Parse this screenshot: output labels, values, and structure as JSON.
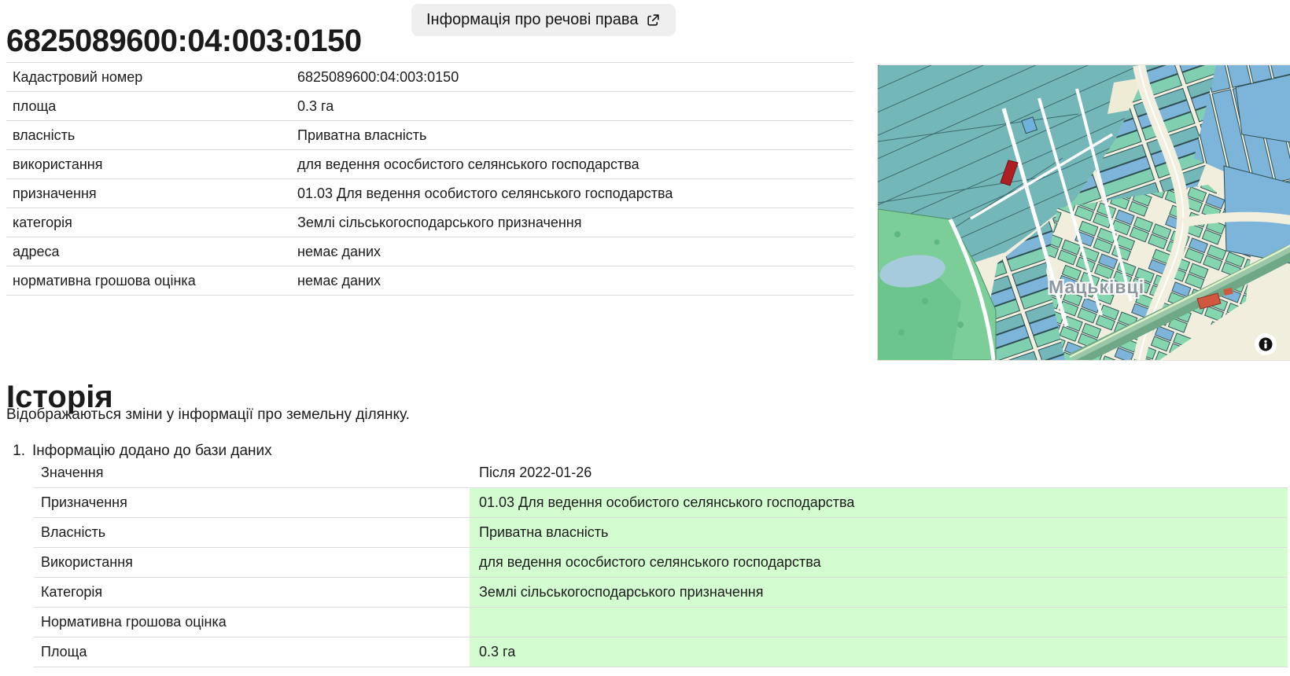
{
  "page": {
    "title": "6825089600:04:003:0150",
    "rights_button": {
      "label": "Інформація про речові права",
      "icon": "external-link-icon"
    }
  },
  "parcel_table": {
    "rows": [
      {
        "label": "Кадастровий номер",
        "value": "6825089600:04:003:0150"
      },
      {
        "label": "площа",
        "value": "0.3 га"
      },
      {
        "label": "власність",
        "value": "Приватна власність"
      },
      {
        "label": "використання",
        "value": "для ведення ососбистого селянського господарства"
      },
      {
        "label": "призначення",
        "value": "01.03 Для ведення особистого селянського господарства"
      },
      {
        "label": "категорія",
        "value": "Землі сільськогосподарського призначення"
      },
      {
        "label": "адреса",
        "value": "немає даних"
      },
      {
        "label": "нормативна грошова оцінка",
        "value": "немає даних"
      }
    ]
  },
  "map": {
    "label": "Мацьківці",
    "info_icon": "info-icon",
    "selected_parcel": "6825089600:04:003:0150",
    "colors": {
      "field_teal": "#73b7b9",
      "parcel_blue": "#7db4d9",
      "parcel_green": "#84d6ae",
      "road_cream": "#f1eedd",
      "forest_green": "#7bce97",
      "water_blue": "#a5cbdd",
      "river_green": "#6fa886",
      "selected_parcel_red": "#ad1f23"
    }
  },
  "history": {
    "heading": "Історія",
    "description": "Відображаються зміни у інформації про земельну ділянку.",
    "highlight_color": "#d4fcd1",
    "entries": [
      {
        "number": "1.",
        "title": "Інформацію додано до бази даних",
        "table": {
          "header": {
            "label": "Значення",
            "value": "Після 2022-01-26"
          },
          "rows": [
            {
              "label": "Призначення",
              "value": "01.03 Для ведення особистого селянського господарства"
            },
            {
              "label": "Власність",
              "value": "Приватна власність"
            },
            {
              "label": "Використання",
              "value": "для ведення ососбистого селянського господарства"
            },
            {
              "label": "Категорія",
              "value": "Землі сільськогосподарського призначення"
            },
            {
              "label": "Нормативна грошова оцінка",
              "value": ""
            },
            {
              "label": "Площа",
              "value": "0.3 га"
            }
          ]
        }
      }
    ]
  }
}
